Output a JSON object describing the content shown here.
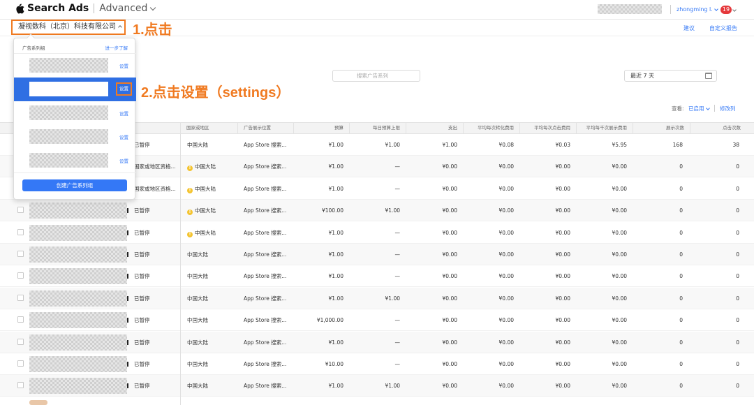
{
  "header": {
    "brand": "Search Ads",
    "mode": "Advanced",
    "user": "zhongming l.",
    "notifications": "19"
  },
  "org": {
    "name": "凝视数科（北京）科技有限公司"
  },
  "top_links": [
    "建议",
    "自定义报告"
  ],
  "annotations": {
    "step1": "1.点击",
    "step2": "2.点击设置（settings）"
  },
  "dropdown": {
    "title": "广告系列组",
    "learn_more": "进一步了解",
    "settings_label": "设置",
    "create_button": "创建广告系列组"
  },
  "toolbar": {
    "search_placeholder": "搜索广告系列",
    "date_range": "最近 7 天",
    "view_label": "查看:",
    "view_value": "已启用",
    "edit_columns": "修改列"
  },
  "table": {
    "columns": [
      "国家或地区",
      "广告展示位置",
      "预算",
      "每日预算上限",
      "支出",
      "平均每次转化费用",
      "平均每次点击费用",
      "平均每千次展示费用",
      "展示次数",
      "点击次数"
    ],
    "rows": [
      {
        "status": "已暂停",
        "warn": false,
        "region": "中国大陆",
        "placement": "App Store 搜索...",
        "budget": "¥1.00",
        "daily_cap": "¥1.00",
        "spend": "¥1.00",
        "cpa": "¥0.08",
        "cpt": "¥0.03",
        "cpm": "¥5.95",
        "impressions": "168",
        "taps": "38"
      },
      {
        "status": "国家或地区资格...",
        "warn": true,
        "region": "中国大陆",
        "placement": "App Store 搜索...",
        "budget": "¥1.00",
        "daily_cap": "—",
        "spend": "¥0.00",
        "cpa": "¥0.00",
        "cpt": "¥0.00",
        "cpm": "¥0.00",
        "impressions": "0",
        "taps": "0"
      },
      {
        "status": "国家或地区资格...",
        "warn": true,
        "region": "中国大陆",
        "placement": "App Store 搜索...",
        "budget": "¥1.00",
        "daily_cap": "—",
        "spend": "¥0.00",
        "cpa": "¥0.00",
        "cpt": "¥0.00",
        "cpm": "¥0.00",
        "impressions": "0",
        "taps": "0"
      },
      {
        "status": "已暂停",
        "warn": true,
        "region": "中国大陆",
        "placement": "App Store 搜索...",
        "budget": "¥100.00",
        "daily_cap": "¥1.00",
        "spend": "¥0.00",
        "cpa": "¥0.00",
        "cpt": "¥0.00",
        "cpm": "¥0.00",
        "impressions": "0",
        "taps": "0"
      },
      {
        "status": "已暂停",
        "warn": true,
        "region": "中国大陆",
        "placement": "App Store 搜索...",
        "budget": "¥1.00",
        "daily_cap": "—",
        "spend": "¥0.00",
        "cpa": "¥0.00",
        "cpt": "¥0.00",
        "cpm": "¥0.00",
        "impressions": "0",
        "taps": "0"
      },
      {
        "status": "已暂停",
        "warn": false,
        "region": "中国大陆",
        "placement": "App Store 搜索...",
        "budget": "¥1.00",
        "daily_cap": "—",
        "spend": "¥0.00",
        "cpa": "¥0.00",
        "cpt": "¥0.00",
        "cpm": "¥0.00",
        "impressions": "0",
        "taps": "0"
      },
      {
        "status": "已暂停",
        "warn": false,
        "region": "中国大陆",
        "placement": "App Store 搜索...",
        "budget": "¥1.00",
        "daily_cap": "—",
        "spend": "¥0.00",
        "cpa": "¥0.00",
        "cpt": "¥0.00",
        "cpm": "¥0.00",
        "impressions": "0",
        "taps": "0"
      },
      {
        "status": "已暂停",
        "warn": false,
        "region": "中国大陆",
        "placement": "App Store 搜索...",
        "budget": "¥1.00",
        "daily_cap": "¥1.00",
        "spend": "¥0.00",
        "cpa": "¥0.00",
        "cpt": "¥0.00",
        "cpm": "¥0.00",
        "impressions": "0",
        "taps": "0"
      },
      {
        "status": "已暂停",
        "warn": false,
        "region": "中国大陆",
        "placement": "App Store 搜索...",
        "budget": "¥1,000.00",
        "daily_cap": "—",
        "spend": "¥0.00",
        "cpa": "¥0.00",
        "cpt": "¥0.00",
        "cpm": "¥0.00",
        "impressions": "0",
        "taps": "0"
      },
      {
        "status": "已暂停",
        "warn": false,
        "region": "中国大陆",
        "placement": "App Store 搜索...",
        "budget": "¥1.00",
        "daily_cap": "—",
        "spend": "¥0.00",
        "cpa": "¥0.00",
        "cpt": "¥0.00",
        "cpm": "¥0.00",
        "impressions": "0",
        "taps": "0"
      },
      {
        "status": "已暂停",
        "warn": false,
        "region": "中国大陆",
        "placement": "App Store 搜索...",
        "budget": "¥10.00",
        "daily_cap": "—",
        "spend": "¥0.00",
        "cpa": "¥0.00",
        "cpt": "¥0.00",
        "cpm": "¥0.00",
        "impressions": "0",
        "taps": "0"
      },
      {
        "status": "已暂停",
        "warn": false,
        "region": "中国大陆",
        "placement": "App Store 搜索...",
        "budget": "¥1.00",
        "daily_cap": "¥1.00",
        "spend": "¥0.00",
        "cpa": "¥0.00",
        "cpt": "¥0.00",
        "cpm": "¥0.00",
        "impressions": "0",
        "taps": "0"
      }
    ]
  },
  "colors": {
    "accent": "#3478f6",
    "annotation": "#f07a21",
    "selected": "#2f6fe3",
    "warning": "#f4c430",
    "badge": "#e5383b"
  }
}
